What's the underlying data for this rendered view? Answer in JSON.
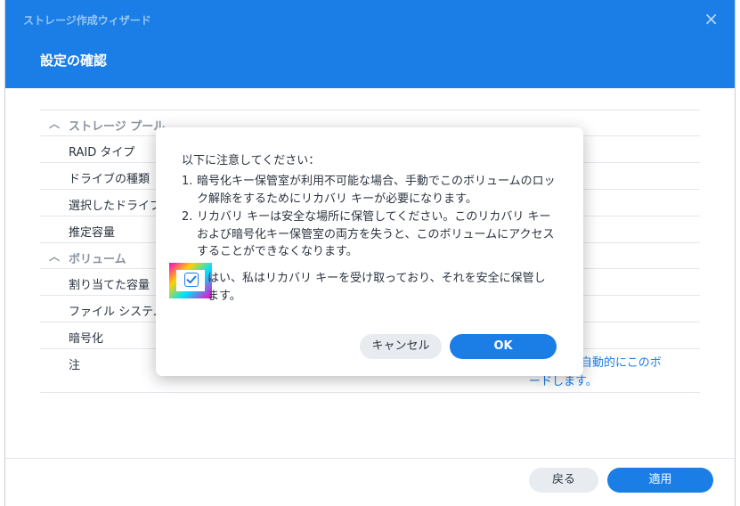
{
  "window": {
    "title": "ストレージ作成ウィザード",
    "close_icon": "×",
    "page_title": "設定の確認"
  },
  "summary": {
    "sections": [
      {
        "title": "ストレージ プール",
        "rows": [
          "RAID タイプ",
          "ドライブの種類",
          "選択したドライブ",
          "推定容量"
        ]
      },
      {
        "title": "ボリューム",
        "rows": [
          "割り当てた容量",
          "ファイル システム",
          "暗号化",
          "注"
        ]
      }
    ],
    "note_value_lines": [
      "自動的にこのボ",
      "　　　　　　　　　　　　　ードします。"
    ]
  },
  "footer": {
    "back_label": "戻る",
    "apply_label": "適用"
  },
  "dialog": {
    "intro": "以下に注意してください：",
    "items": [
      {
        "num": "1.",
        "text": "暗号化キー保管室が利用不可能な場合、手動でこのボリュームのロック解除をするためにリカバリ キーが必要になります。"
      },
      {
        "num": "2.",
        "text": "リカバリ キーは安全な場所に保管してください。このリカバリ キーおよび暗号化キー保管室の両方を失うと、このボリュームにアクセスすることができなくなります。"
      }
    ],
    "checkbox_label": "はい、私はリカバリ キーを受け取っており、それを安全に保管します。",
    "checkbox_checked": true,
    "cancel_label": "キャンセル",
    "ok_label": "OK"
  },
  "colors": {
    "accent": "#1a7ee6",
    "secondary_button": "#e8ecf1"
  }
}
